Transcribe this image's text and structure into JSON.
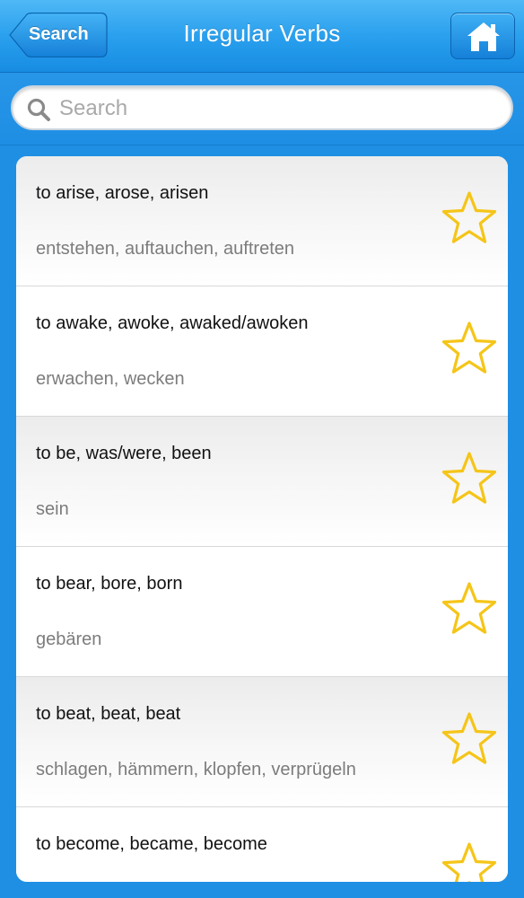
{
  "nav": {
    "title": "Irregular Verbs",
    "back_label": "Search"
  },
  "search": {
    "placeholder": "Search",
    "value": ""
  },
  "colors": {
    "nav_blue": "#2aa0ee",
    "star_yellow": "#f5c518",
    "secondary_text": "#7c7c7c"
  },
  "icons": {
    "back": "chevron-left-button",
    "home": "house-icon",
    "search": "magnifier-icon",
    "favorite": "star-outline-icon"
  },
  "verbs": [
    {
      "forms": "to arise, arose, arisen",
      "translation": "entstehen, auftauchen, auftreten",
      "favorite": false
    },
    {
      "forms": "to awake, awoke, awaked/awoken",
      "translation": "erwachen, wecken",
      "favorite": false
    },
    {
      "forms": "to be, was/were, been",
      "translation": "sein",
      "favorite": false
    },
    {
      "forms": "to bear, bore, born",
      "translation": "gebären",
      "favorite": false
    },
    {
      "forms": "to beat, beat, beat",
      "translation": "schlagen, hämmern, klopfen, verprügeln",
      "favorite": false
    },
    {
      "forms": "to become, became, become",
      "translation": "",
      "favorite": false
    }
  ]
}
